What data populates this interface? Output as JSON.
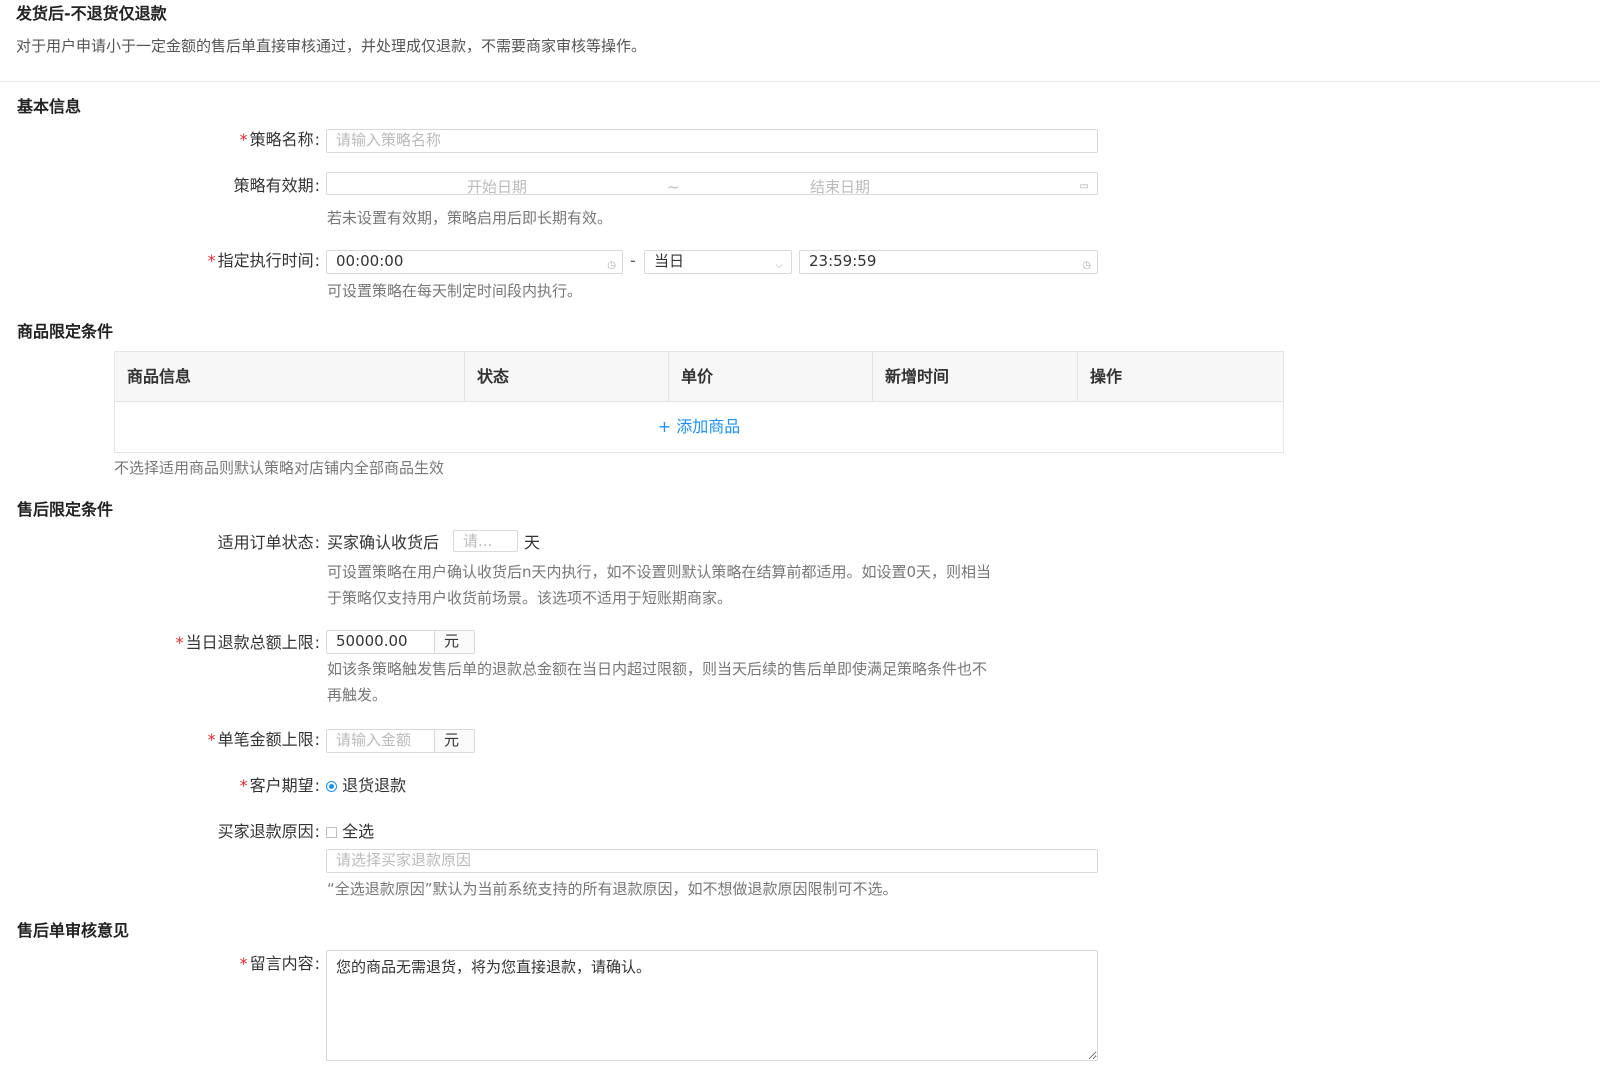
{
  "header": {
    "title": "发货后-不退货仅退款",
    "description": "对于用户申请小于一定金额的售后单直接审核通过，并处理成仅退款，不需要商家审核等操作。"
  },
  "basic": {
    "section_title": "基本信息",
    "name_label": "策略名称",
    "name_placeholder": "请输入策略名称",
    "validity_label": "策略有效期",
    "start_placeholder": "开始日期",
    "range_sep": "~",
    "end_placeholder": "结束日期",
    "validity_hint": "若未设置有效期，策略启用后即长期有效。",
    "exec_label": "指定执行时间",
    "exec_start": "00:00:00",
    "exec_dash": "-",
    "exec_day": "当日",
    "exec_end": "23:59:59",
    "exec_hint": "可设置策略在每天制定时间段内执行。"
  },
  "goods": {
    "section_title": "商品限定条件",
    "columns": [
      "商品信息",
      "状态",
      "单价",
      "新增时间",
      "操作"
    ],
    "add_label": "+ 添加商品",
    "hint": "不选择适用商品则默认策略对店铺内全部商品生效"
  },
  "aftersale": {
    "section_title": "售后限定条件",
    "order_status_label": "适用订单状态",
    "order_status_prefix": "买家确认收货后",
    "days_placeholder": "请...",
    "days_unit": "天",
    "order_status_hint_1": "可设置策略在用户确认收货后n天内执行，如不设置则默认策略在结算前都适用。如设置0天，则相当",
    "order_status_hint_2": "于策略仅支持用户收货前场景。该选项不适用于短账期商家。",
    "daily_limit_label": "当日退款总额上限",
    "daily_limit_value": "50000.00",
    "currency_unit": "元",
    "daily_limit_hint_1": "如该条策略触发售后单的退款总金额在当日内超过限额，则当天后续的售后单即使满足策略条件也不",
    "daily_limit_hint_2": "再触发。",
    "single_limit_label": "单笔金额上限",
    "single_limit_placeholder": "请输入金额",
    "expectation_label": "客户期望",
    "expectation_option": "退货退款",
    "reason_label": "买家退款原因",
    "select_all_label": "全选",
    "reason_placeholder": "请选择买家退款原因",
    "reason_hint": "“全选退款原因”默认为当前系统支持的所有退款原因，如不想做退款原因限制可不选。"
  },
  "review": {
    "section_title": "售后单审核意见",
    "message_label": "留言内容",
    "message_value": "您的商品无需退货，将为您直接退款，请确认。"
  },
  "icons": {
    "calendar": "calendar-icon",
    "clock": "clock-icon",
    "chevron": "chevron-down-icon"
  },
  "colors": {
    "required": "#f5222d",
    "link": "#1890ff"
  }
}
